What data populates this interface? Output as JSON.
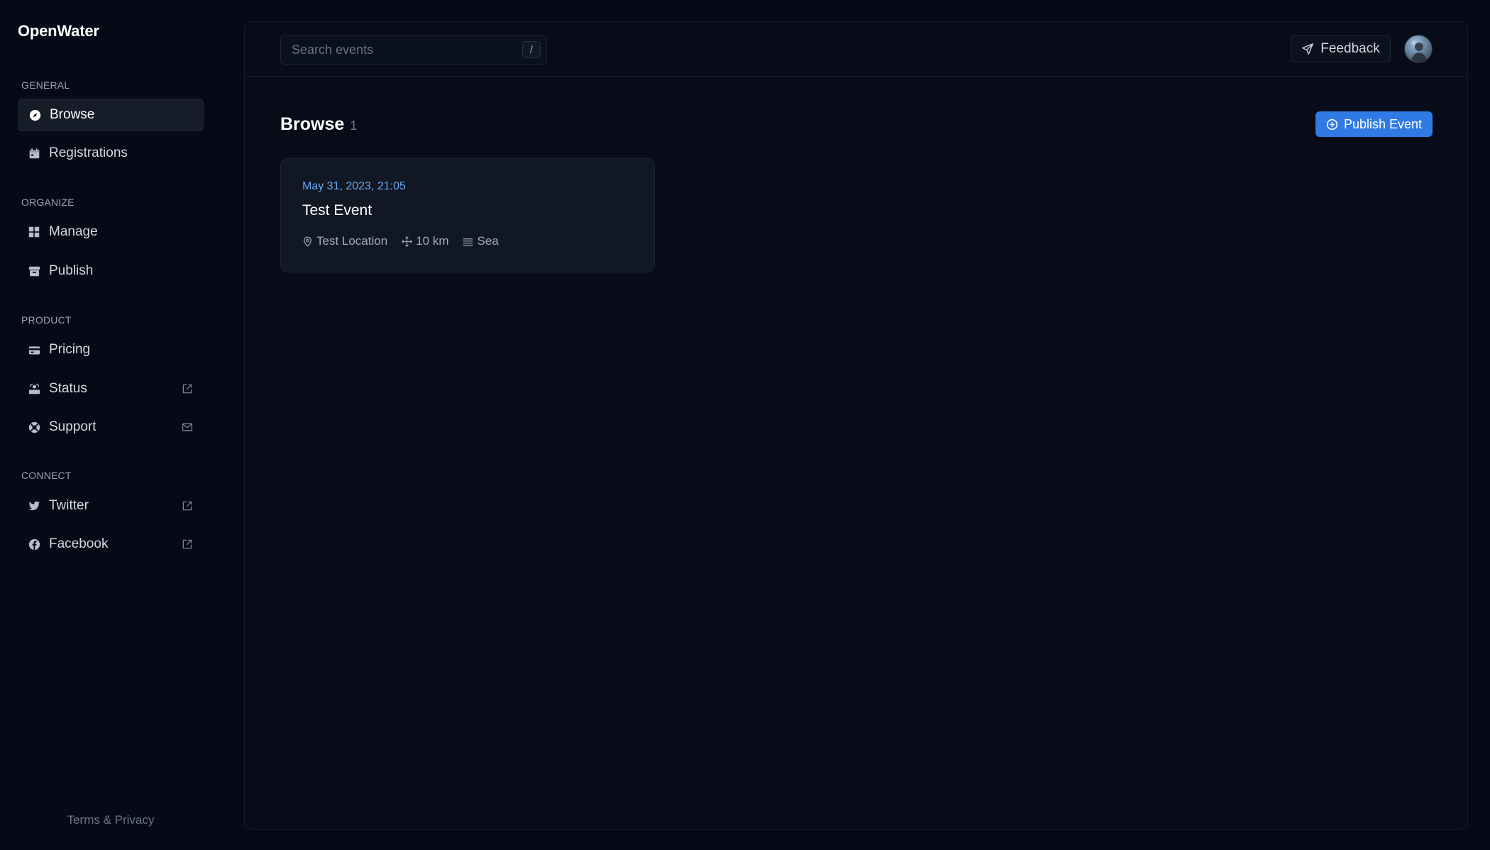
{
  "brand": "OpenWater",
  "sidebar": {
    "sections": [
      {
        "label": "GENERAL"
      },
      {
        "label": "ORGANIZE"
      },
      {
        "label": "PRODUCT"
      },
      {
        "label": "CONNECT"
      }
    ],
    "items": [
      {
        "label": "Browse",
        "icon": "compass-icon",
        "active": true
      },
      {
        "label": "Registrations",
        "icon": "calendar-icon"
      },
      {
        "label": "Manage",
        "icon": "grid-icon"
      },
      {
        "label": "Publish",
        "icon": "archive-icon"
      },
      {
        "label": "Pricing",
        "icon": "credit-card-icon"
      },
      {
        "label": "Status",
        "icon": "status-icon",
        "ext": "external-link-icon"
      },
      {
        "label": "Support",
        "icon": "lifebuoy-icon",
        "ext": "mail-icon"
      },
      {
        "label": "Twitter",
        "icon": "twitter-icon",
        "ext": "external-link-icon"
      },
      {
        "label": "Facebook",
        "icon": "facebook-icon",
        "ext": "external-link-icon"
      }
    ],
    "footer": "Terms & Privacy"
  },
  "topbar": {
    "search_placeholder": "Search events",
    "search_value": "",
    "search_shortcut": "/",
    "feedback_label": "Feedback"
  },
  "page": {
    "title": "Browse",
    "count": "1",
    "publish_label": "Publish Event"
  },
  "events": [
    {
      "date": "May 31, 2023, 21:05",
      "title": "Test Event",
      "location": "Test Location",
      "distance": "10 km",
      "water": "Sea"
    }
  ],
  "colors": {
    "background": "#050a16",
    "panel": "#070c18",
    "card": "#111823",
    "accent": "#2f7ae5",
    "date": "#6aa7f2"
  }
}
